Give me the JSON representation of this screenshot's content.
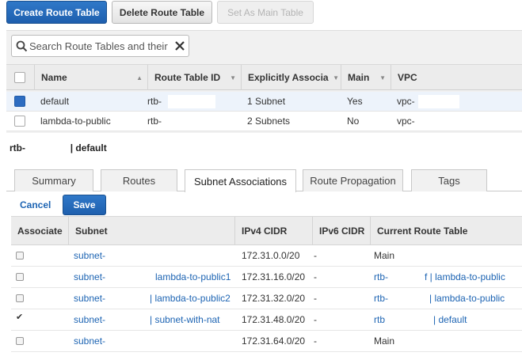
{
  "toolbar": {
    "create_label": "Create Route Table",
    "delete_label": "Delete Route Table",
    "set_main_label": "Set As Main Table"
  },
  "search": {
    "placeholder": "Search Route Tables and their"
  },
  "route_tables": {
    "columns": [
      "Name",
      "Route Table ID",
      "Explicitly Associa",
      "Main",
      "VPC"
    ],
    "rows": [
      {
        "name": "default",
        "id": "rtb-",
        "assoc": "1 Subnet",
        "main": "Yes",
        "vpc": "vpc-",
        "selected": true
      },
      {
        "name": "lambda-to-public",
        "id": "rtb-",
        "assoc": "2 Subnets",
        "main": "No",
        "vpc": "vpc-",
        "selected": false
      }
    ]
  },
  "detail": {
    "id": "rtb-",
    "name": "| default"
  },
  "tabs": [
    "Summary",
    "Routes",
    "Subnet Associations",
    "Route Propagation",
    "Tags"
  ],
  "actions": {
    "cancel": "Cancel",
    "save": "Save"
  },
  "subnets": {
    "columns": [
      "Associate",
      "Subnet",
      "IPv4 CIDR",
      "IPv6 CIDR",
      "Current Route Table"
    ],
    "rows": [
      {
        "checked": false,
        "subnet": "subnet-",
        "subnet_name": "",
        "ipv4": "172.31.0.0/20",
        "ipv6": "-",
        "rt": "Main",
        "rt_prefix": "",
        "rt_name": ""
      },
      {
        "checked": false,
        "subnet": "subnet-",
        "subnet_name": "lambda-to-public1",
        "ipv4": "172.31.16.0/20",
        "ipv6": "-",
        "rt": "",
        "rt_prefix": "rtb-",
        "rt_name": "f | lambda-to-public"
      },
      {
        "checked": false,
        "subnet": "subnet-",
        "subnet_name": "| lambda-to-public2",
        "ipv4": "172.31.32.0/20",
        "ipv6": "-",
        "rt": "",
        "rt_prefix": "rtb-",
        "rt_name": "| lambda-to-public"
      },
      {
        "checked": true,
        "subnet": "subnet-",
        "subnet_name": "| subnet-with-nat",
        "ipv4": "172.31.48.0/20",
        "ipv6": "-",
        "rt": "",
        "rt_prefix": "rtb",
        "rt_name": "| default"
      },
      {
        "checked": false,
        "subnet": "subnet-",
        "subnet_name": "",
        "ipv4": "172.31.64.0/20",
        "ipv6": "-",
        "rt": "Main",
        "rt_prefix": "",
        "rt_name": ""
      }
    ]
  }
}
